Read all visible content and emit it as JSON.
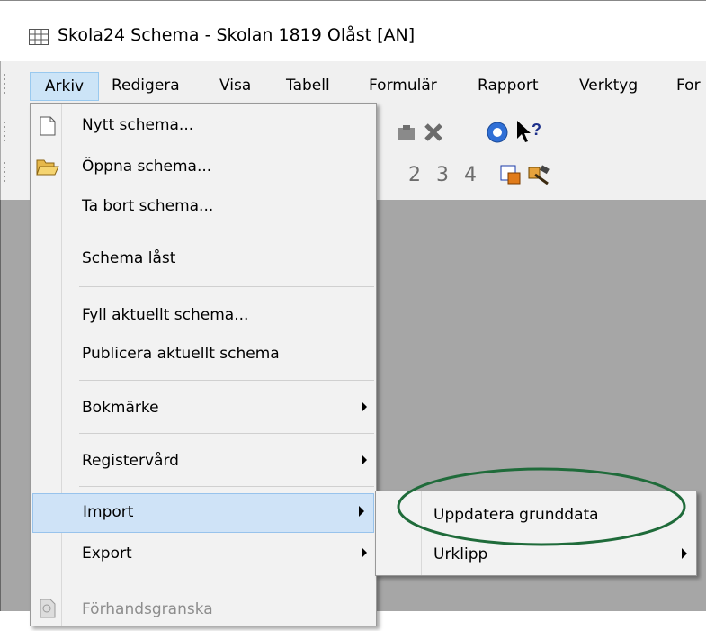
{
  "window": {
    "title": "Skola24 Schema - Skolan 1819  Olåst  [AN]"
  },
  "menubar": {
    "items": [
      "Arkiv",
      "Redigera",
      "Visa",
      "Tabell",
      "Formulär",
      "Rapport",
      "Verktyg",
      "For"
    ]
  },
  "toolbar": {
    "numbers": [
      "2",
      "3",
      "4"
    ]
  },
  "arkiv_menu": {
    "items": [
      {
        "label": "Nytt schema...",
        "icon": "new-document-icon"
      },
      {
        "label": "Öppna schema...",
        "icon": "open-folder-icon"
      },
      {
        "label": "Ta bort schema..."
      },
      {
        "label": "Schema låst"
      },
      {
        "label": "Fyll aktuellt schema..."
      },
      {
        "label": "Publicera aktuellt schema"
      },
      {
        "label": "Bokmärke",
        "submenu": true
      },
      {
        "label": "Registervård",
        "submenu": true
      },
      {
        "label": "Import",
        "submenu": true,
        "highlighted": true
      },
      {
        "label": "Export",
        "submenu": true
      },
      {
        "label": "Förhandsgranska",
        "disabled": true,
        "icon": "print-preview-icon"
      }
    ]
  },
  "import_submenu": {
    "items": [
      {
        "label": "Uppdatera grunddata"
      },
      {
        "label": "Urklipp",
        "submenu": true
      }
    ]
  },
  "colors": {
    "menu_highlight": "#cfe3f7",
    "client_background": "#a6a6a6",
    "annotation_ellipse": "#1f6b3a"
  }
}
